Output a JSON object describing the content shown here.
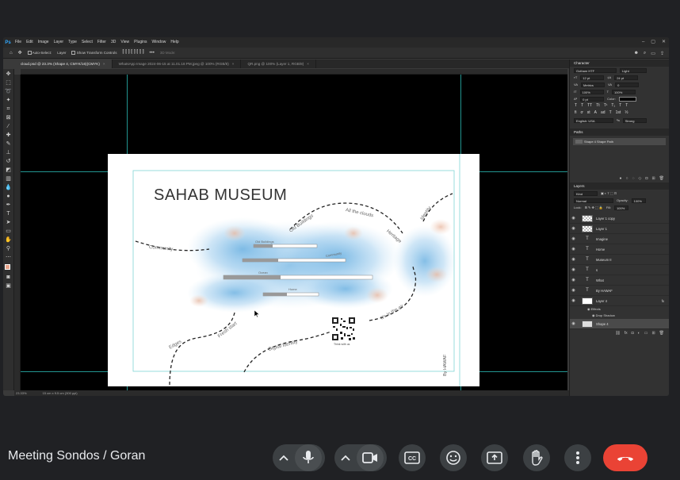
{
  "photoshop": {
    "menu": [
      "File",
      "Edit",
      "Image",
      "Layer",
      "Type",
      "Select",
      "Filter",
      "3D",
      "View",
      "Plugins",
      "Window",
      "Help"
    ],
    "options": {
      "auto_select": "Auto-Select:",
      "auto_select_value": "Layer",
      "transform_controls": "Show Transform Controls",
      "mode_3d": "3D Mode:"
    },
    "tabs": [
      {
        "label": "cloud.psd @ 23.3% (Shape 4, CMYK/16)(CMYK)",
        "active": true
      },
      {
        "label": "WhatsApp Image 2024-06-15 at 11.01.18 PM.jpeg @ 100% (RGB/8)",
        "active": false
      },
      {
        "label": "QR.png @ 100% (Layer 1, RGB/8)",
        "active": false
      }
    ],
    "status": {
      "zoom": "23.33%",
      "doc_size": "15 cm x 9.5 cm (300 ppi)"
    },
    "document": {
      "title": "SAHAB MUSEUM",
      "menu_items": [
        "Old Buildings",
        "Community",
        "Ocean",
        "Home"
      ],
      "path_labels": [
        "Old Buildings",
        "All the clouds",
        "Identity",
        "Heritage",
        "Community",
        "Edges",
        "Fresh start",
        "Digital Identity",
        "It's in the air"
      ],
      "qr_caption": "Think with us",
      "signature": "By HAWAF"
    },
    "character_panel": {
      "tab": "Character",
      "font_family": "Gotham HTF",
      "font_style": "Light",
      "font_size": "12 pt",
      "leading": "24 pt",
      "kerning": "Metrics",
      "tracking": "0",
      "vscale": "100%",
      "hscale": "100%",
      "baseline": "0 pt",
      "color_label": "Color:",
      "language": "English: USA",
      "antialias": "Strong"
    },
    "paths_panel": {
      "tab": "Paths",
      "item": "Shape 4 Shape Path"
    },
    "layers_panel": {
      "tab": "Layers",
      "filter": "Kind",
      "blend": "Normal",
      "opacity_label": "Opacity:",
      "opacity": "100%",
      "lock_label": "Lock:",
      "fill_label": "Fill:",
      "fill": "100%",
      "layers": [
        {
          "name": "Layer 1 copy",
          "kind": "raster"
        },
        {
          "name": "Layer 1",
          "kind": "raster"
        },
        {
          "name": "Imagine",
          "kind": "text"
        },
        {
          "name": "Home",
          "kind": "text"
        },
        {
          "name": "Museum II",
          "kind": "text"
        },
        {
          "name": "s",
          "kind": "text"
        },
        {
          "name": "What",
          "kind": "text"
        },
        {
          "name": "By HAWAF",
          "kind": "text"
        },
        {
          "name": "Layer 4",
          "kind": "raster",
          "fx": "fx"
        },
        {
          "name": "Shape 4",
          "kind": "shape",
          "selected": true
        }
      ],
      "effects_label": "Effects",
      "drop_shadow": "Drop Shadow"
    }
  },
  "meet": {
    "meeting_title": "Meeting Sondos / Goran",
    "buttons": [
      "mic-options",
      "microphone",
      "camera-options",
      "camera",
      "captions",
      "emoji",
      "present",
      "raise-hand",
      "more-options",
      "leave-call"
    ],
    "colors": {
      "end_call": "#ea4335",
      "control": "#3c4043"
    }
  }
}
